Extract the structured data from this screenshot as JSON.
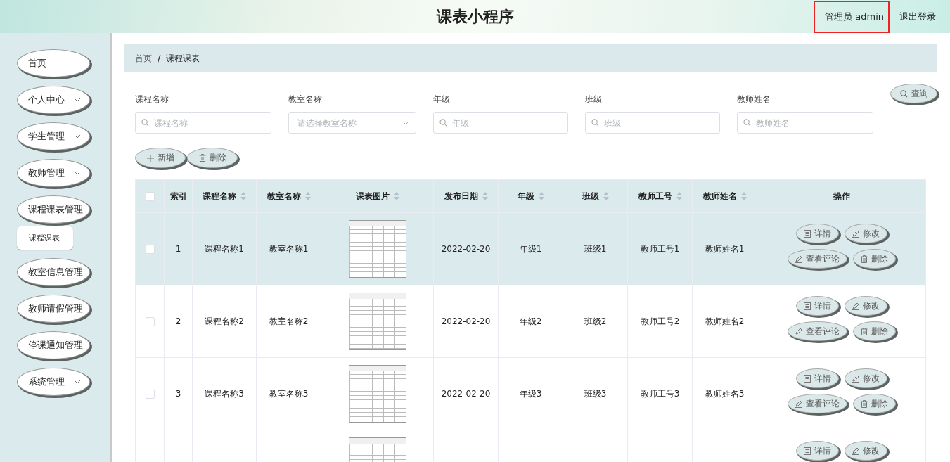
{
  "header": {
    "title": "课表小程序",
    "user": {
      "label": "管理员 admin",
      "highlighted": true
    },
    "logout": "退出登录"
  },
  "sidebar": {
    "items": [
      {
        "label": "首页",
        "submenu": false
      },
      {
        "label": "个人中心",
        "submenu": true
      },
      {
        "label": "学生管理",
        "submenu": true
      },
      {
        "label": "教师管理",
        "submenu": true
      },
      {
        "label": "课程课表管理",
        "submenu": false,
        "children": [
          {
            "label": "课程课表"
          }
        ]
      },
      {
        "label": "教室信息管理",
        "submenu": false
      },
      {
        "label": "教师请假管理",
        "submenu": false
      },
      {
        "label": "停课通知管理",
        "submenu": false
      },
      {
        "label": "系统管理",
        "submenu": true
      }
    ]
  },
  "breadcrumb": {
    "items": [
      "首页",
      "课程课表"
    ],
    "separator": "/"
  },
  "filters": {
    "fields": [
      {
        "label": "课程名称",
        "kind": "input",
        "placeholder": "课程名称"
      },
      {
        "label": "教室名称",
        "kind": "select",
        "placeholder": "请选择教室名称"
      },
      {
        "label": "年级",
        "kind": "input",
        "placeholder": "年级"
      },
      {
        "label": "班级",
        "kind": "input",
        "placeholder": "班级"
      },
      {
        "label": "教师姓名",
        "kind": "input",
        "placeholder": "教师姓名"
      }
    ],
    "search_button": "查询"
  },
  "toolbar": [
    {
      "label": "新增",
      "kind": "add"
    },
    {
      "label": "删除",
      "kind": "delete"
    }
  ],
  "table": {
    "select_all": {
      "checked": false
    },
    "columns": [
      {
        "label": "索引",
        "sortable": false
      },
      {
        "label": "课程名称",
        "sortable": true
      },
      {
        "label": "教室名称",
        "sortable": true
      },
      {
        "label": "课表图片",
        "sortable": true
      },
      {
        "label": "发布日期",
        "sortable": true
      },
      {
        "label": "年级",
        "sortable": true
      },
      {
        "label": "班级",
        "sortable": true
      },
      {
        "label": "教师工号",
        "sortable": true
      },
      {
        "label": "教师姓名",
        "sortable": true
      },
      {
        "label": "操作",
        "sortable": false
      }
    ],
    "rows": [
      {
        "highlighted": true,
        "checked": false,
        "cells": [
          "1",
          "课程名称1",
          "教室名称1",
          null,
          "2022-02-20",
          "年级1",
          "班级1",
          "教师工号1",
          "教师姓名1"
        ],
        "actions": [
          {
            "label": "详情",
            "kind": "detail"
          },
          {
            "label": "修改",
            "kind": "edit"
          },
          {
            "label": "查看评论",
            "kind": "comment"
          },
          {
            "label": "删除",
            "kind": "delete"
          }
        ]
      },
      {
        "highlighted": false,
        "checked": false,
        "cells": [
          "2",
          "课程名称2",
          "教室名称2",
          null,
          "2022-02-20",
          "年级2",
          "班级2",
          "教师工号2",
          "教师姓名2"
        ],
        "actions": [
          {
            "label": "详情",
            "kind": "detail"
          },
          {
            "label": "修改",
            "kind": "edit"
          },
          {
            "label": "查看评论",
            "kind": "comment"
          },
          {
            "label": "删除",
            "kind": "delete"
          }
        ]
      },
      {
        "highlighted": false,
        "checked": false,
        "cells": [
          "3",
          "课程名称3",
          "教室名称3",
          null,
          "2022-02-20",
          "年级3",
          "班级3",
          "教师工号3",
          "教师姓名3"
        ],
        "actions": [
          {
            "label": "详情",
            "kind": "detail"
          },
          {
            "label": "修改",
            "kind": "edit"
          },
          {
            "label": "查看评论",
            "kind": "comment"
          },
          {
            "label": "删除",
            "kind": "delete"
          }
        ]
      },
      {
        "highlighted": false,
        "cells": [
          null,
          null,
          null,
          null,
          null,
          null,
          null,
          null,
          null
        ],
        "actions": [
          {
            "label": "详情",
            "kind": "detail"
          },
          {
            "label": "修改",
            "kind": "edit"
          }
        ]
      }
    ]
  }
}
